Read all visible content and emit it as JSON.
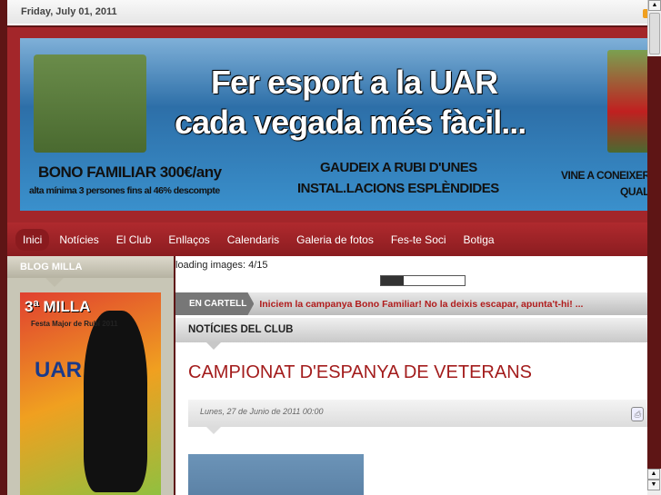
{
  "topbar": {
    "date": "Friday, July 01, 2011"
  },
  "banner": {
    "line1": "Fer esport  a la UAR",
    "line2": "cada vegada més fàcil...",
    "bono": "BONO FAMILIAR 300€/any",
    "bono_sub": "alta mínima 3 persones fins al 46% descompte",
    "gaudeix1": "GAUDEIX A RUBI D'UNES",
    "gaudeix2": "INSTAL.LACIONS ESPLÈNDIDES",
    "vine1": "VINE A CONEIXER",
    "vine2": "QUALS"
  },
  "nav": {
    "items": [
      "Inici",
      "Notícies",
      "El Club",
      "Enllaços",
      "Calendaris",
      "Galeria de fotos",
      "Fes-te Soci",
      "Botiga"
    ],
    "active": 0
  },
  "sidebar": {
    "title": "BLOG MILLA",
    "poster": {
      "title": "3ª MILLA",
      "subtitle": "Festa Major de Rubí 2011",
      "club": "UAR"
    }
  },
  "main": {
    "loading": "loading images: 4/15",
    "loading_progress": 0.27,
    "cartell_label": "EN CARTELL",
    "cartell_text": "Iniciem la campanya Bono Familiar! No la deixis escapar, apunta't-hi! ...",
    "section": "NOTÍCIES DEL CLUB",
    "article_title": "CAMPIONAT D'ESPANYA DE VETERANS",
    "article_date": "Lunes, 27 de Junio de 2011 00:00"
  }
}
